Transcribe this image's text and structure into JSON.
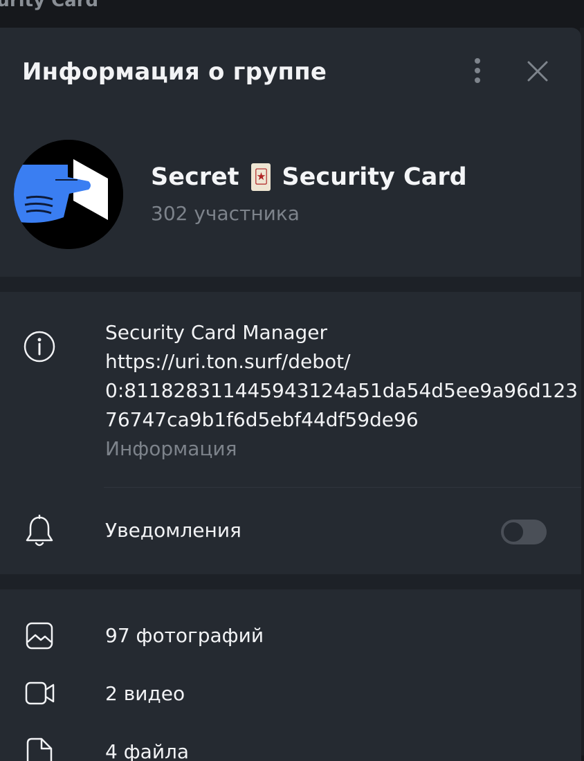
{
  "background_window": {
    "title": "curity Card"
  },
  "header": {
    "title": "Информация о группе"
  },
  "group": {
    "name_part1": "Secret",
    "name_part2": "Security Card",
    "members": "302 участника"
  },
  "info": {
    "lines": [
      "Security Card Manager",
      "https://uri.ton.surf/debot/",
      "0:81182831144594312​4a51da54d5ee9a96d123",
      "76747ca9b1f6d5ebf44df59de96"
    ],
    "caption": "Информация"
  },
  "notifications": {
    "label": "Уведомления",
    "enabled": false
  },
  "media": [
    {
      "icon": "photo-icon",
      "label": "97 фотографий"
    },
    {
      "icon": "video-icon",
      "label": "2 видео"
    },
    {
      "icon": "file-icon",
      "label": "4 файла"
    }
  ],
  "colors": {
    "panel_bg": "#252a31",
    "separator": "#1d2127",
    "text_primary": "#f2f3f5",
    "text_secondary": "#7d838b",
    "avatar_hand": "#3a7ef2"
  }
}
